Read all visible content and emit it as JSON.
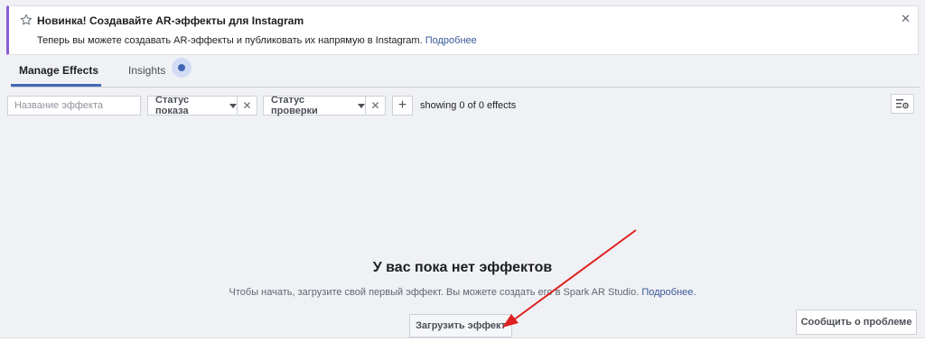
{
  "notice": {
    "title": "Новинка! Создавайте AR-эффекты для Instagram",
    "body": "Теперь вы можете создавать AR-эффекты и публиковать их напрямую в Instagram.",
    "link": "Подробнее",
    "accent_color": "#8a5bd6"
  },
  "tabs": [
    {
      "label": "Manage Effects",
      "active": true
    },
    {
      "label": "Insights",
      "active": false
    }
  ],
  "filters": {
    "search_placeholder": "Название эффекта",
    "status_show": "Статус показа",
    "status_review": "Статус проверки",
    "showing": "showing 0 of 0 effects"
  },
  "empty_state": {
    "title": "У вас пока нет эффектов",
    "description": "Чтобы начать, загрузите свой первый эффект. Вы можете создать его в Spark AR Studio.",
    "link": "Подробнее.",
    "upload_button": "Загрузить эффект"
  },
  "report_button": "Сообщить о проблеме",
  "colors": {
    "link": "#385898",
    "tab_accent": "#4267b2",
    "annotation_arrow": "#e02020"
  }
}
